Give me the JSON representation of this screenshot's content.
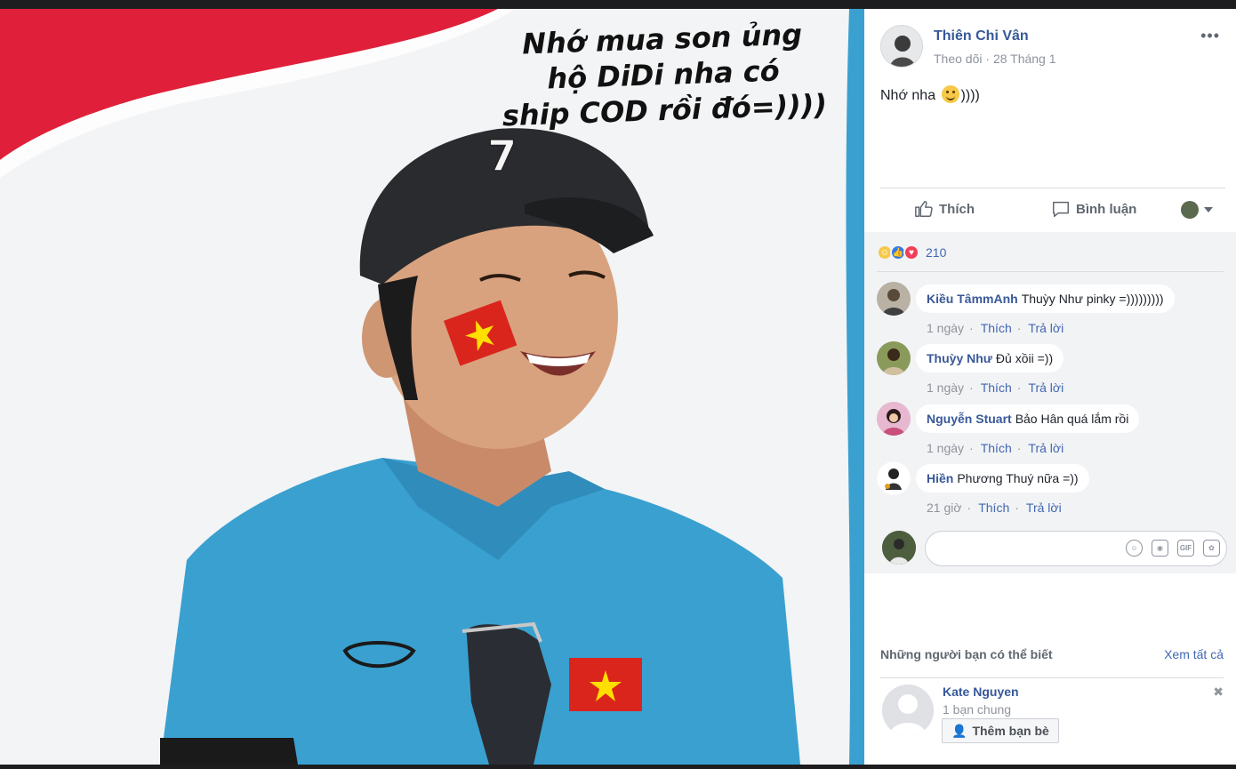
{
  "photo": {
    "caption_lines": [
      "Nhớ mua son ủng",
      "hộ DiDi nha có",
      "ship COD rồi đó=))))"
    ]
  },
  "post": {
    "author": "Thiên Chi Vân",
    "follow_label": "Theo dõi",
    "date": "28 Tháng 1",
    "more_label": "•••",
    "text_before_emoji": "Nhớ nha",
    "text_after_emoji": "))))"
  },
  "actions": {
    "like_label": "Thích",
    "comment_label": "Bình luận"
  },
  "reactions": {
    "count": "210",
    "types": [
      "haha",
      "like",
      "love"
    ]
  },
  "comments": [
    {
      "name": "Kiều TâmmAnh",
      "text": "Thuỳy Như pinky =)))))))))",
      "time": "1 ngày",
      "like": "Thích",
      "reply": "Trả lời"
    },
    {
      "name": "Thuỳy Như",
      "text": "Đủ xồii =))",
      "time": "1 ngày",
      "like": "Thích",
      "reply": "Trả lời"
    },
    {
      "name": "Nguyễn Stuart",
      "text": "Bảo Hân quá lắm rồi",
      "time": "1 ngày",
      "like": "Thích",
      "reply": "Trả lời"
    },
    {
      "name": "Hiền",
      "text": "Phương Thuý nữa =))",
      "time": "21 giờ",
      "like": "Thích",
      "reply": "Trả lời"
    }
  ],
  "reply_box": {
    "value": "",
    "icons": [
      "emoji-icon",
      "camera-icon",
      "gif-icon",
      "sticker-icon"
    ]
  },
  "suggestions": {
    "title": "Những người bạn có thể biết",
    "see_all": "Xem tất cả",
    "people": [
      {
        "name": "Kate Nguyen",
        "mutual": "1 bạn chung",
        "button": "Thêm bạn bè"
      }
    ]
  },
  "colors": {
    "link_blue": "#365899",
    "comment_bg": "#f2f3f5",
    "shirt_blue": "#3aa0d0"
  }
}
